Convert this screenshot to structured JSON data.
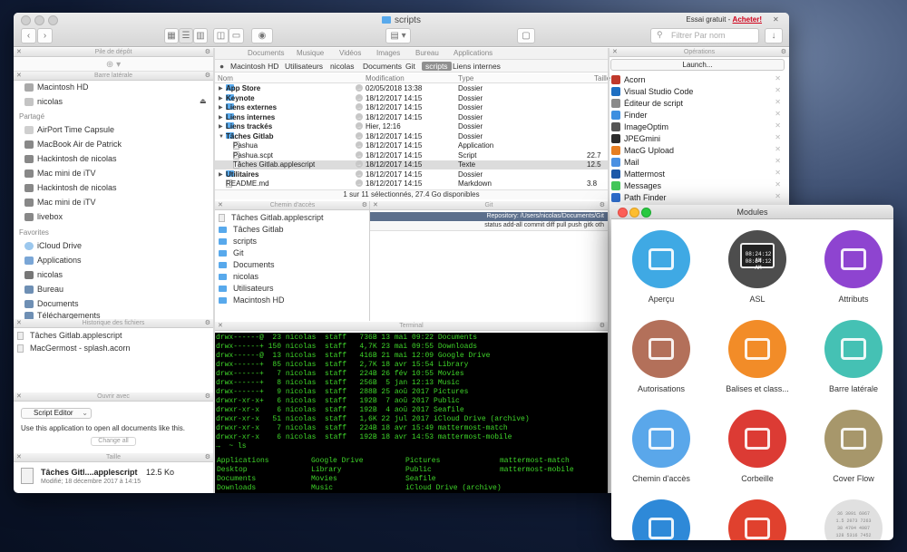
{
  "window": {
    "title": "scripts",
    "trial_label": "Essai gratuit - ",
    "trial_link": "Acheter!",
    "search_placeholder": "Filtrer Par nom"
  },
  "panels": {
    "stack": "Pile de dépôt",
    "sidebar": "Barre latérale",
    "history": "Historique des fichiers",
    "openwith": "Ouvrir avec",
    "size": "Taille",
    "path": "Chemin d'accès",
    "git": "Git",
    "terminal": "Terminal",
    "operations": "Opérations"
  },
  "sidebar": {
    "top": [
      {
        "label": "Macintosh HD"
      },
      {
        "label": "nicolas"
      }
    ],
    "shared_title": "Partagé",
    "shared": [
      {
        "label": "AirPort Time Capsule"
      },
      {
        "label": "MacBook Air de Patrick"
      },
      {
        "label": "Hackintosh de nicolas"
      },
      {
        "label": "Mac mini de iTV"
      },
      {
        "label": "Hackintosh de nicolas"
      },
      {
        "label": "Mac mini de iTV"
      },
      {
        "label": "livebox"
      }
    ],
    "fav_title": "Favorites",
    "favorites": [
      {
        "label": "iCloud Drive"
      },
      {
        "label": "Applications"
      },
      {
        "label": "nicolas"
      },
      {
        "label": "Bureau"
      },
      {
        "label": "Documents"
      },
      {
        "label": "Téléchargements"
      }
    ]
  },
  "history": [
    {
      "label": "Tâches Gitlab.applescript"
    },
    {
      "label": "MacGermost - splash.acorn"
    }
  ],
  "openwith": {
    "app": "Script Editor",
    "desc": "Use this application to open all documents like this.",
    "change": "Change all"
  },
  "sizeinfo": {
    "name": "Tâches Gitl....applescript",
    "size": "12.5 Ko",
    "modified": "Modifié; 18 décembre 2017 à 14:15"
  },
  "menubar": [
    "Documents",
    "Musique",
    "Vidéos",
    "Images",
    "Bureau",
    "Applications"
  ],
  "breadcrumbs": [
    "Macintosh HD",
    "Utilisateurs",
    "nicolas",
    "Documents",
    "Git",
    "scripts",
    "Liens internes"
  ],
  "columns": {
    "name": "Nom",
    "modified": "Modification",
    "type": "Type",
    "size": "Taille"
  },
  "files": [
    {
      "name": "App Store",
      "date": "02/05/2018 13:38",
      "type": "Dossier",
      "size": "",
      "folder": true,
      "bold": true,
      "exp": "▶"
    },
    {
      "name": "Keynote",
      "date": "18/12/2017 14:15",
      "type": "Dossier",
      "size": "",
      "folder": true,
      "bold": true,
      "exp": "▶"
    },
    {
      "name": "Liens externes",
      "date": "18/12/2017 14:15",
      "type": "Dossier",
      "size": "",
      "folder": true,
      "bold": true,
      "exp": "▶"
    },
    {
      "name": "Liens internes",
      "date": "18/12/2017 14:15",
      "type": "Dossier",
      "size": "",
      "folder": true,
      "bold": true,
      "exp": "▶"
    },
    {
      "name": "Liens trackés",
      "date": "Hier, 12:16",
      "type": "Dossier",
      "size": "",
      "folder": true,
      "bold": true,
      "exp": "▶"
    },
    {
      "name": "Tâches Gitlab",
      "date": "18/12/2017 14:15",
      "type": "Dossier",
      "size": "",
      "folder": true,
      "bold": true,
      "exp": "▼"
    },
    {
      "name": "Pashua",
      "date": "18/12/2017 14:15",
      "type": "Application",
      "size": "",
      "folder": false,
      "bold": false,
      "exp": ""
    },
    {
      "name": "Pashua.scpt",
      "date": "18/12/2017 14:15",
      "type": "Script",
      "size": "22.7",
      "folder": false,
      "bold": false,
      "exp": ""
    },
    {
      "name": "Tâches Gitlab.applescript",
      "date": "18/12/2017 14:15",
      "type": "Texte",
      "size": "12.5",
      "folder": false,
      "bold": false,
      "exp": ""
    },
    {
      "name": "Utilitaires",
      "date": "18/12/2017 14:15",
      "type": "Dossier",
      "size": "",
      "folder": true,
      "bold": true,
      "exp": "▶"
    },
    {
      "name": "README.md",
      "date": "18/12/2017 14:15",
      "type": "Markdown",
      "size": "3.8",
      "folder": false,
      "bold": false,
      "exp": ""
    }
  ],
  "status_text": "1 sur 11 sélectionnés, 27.4 Go disponibles",
  "pathlist": [
    "Tâches Gitlab.applescript",
    "Tâches Gitlab",
    "scripts",
    "Git",
    "Documents",
    "nicolas",
    "Utilisateurs",
    "Macintosh HD"
  ],
  "git": {
    "repo": "Repository: /Users/nicolas/Documents/Git",
    "buttons": "status  add-all  commit  diff  pull  push  gitk  oth"
  },
  "terminal": {
    "lines": [
      "drwx------@  23 nicolas  staff   736B 13 mai 09:22 Documents",
      "drwx------+ 150 nicolas  staff   4,7K 23 mai 09:55 Downloads",
      "drwx------@  13 nicolas  staff   416B 21 mai 12:09 Google Drive",
      "drwx------+  85 nicolas  staff   2,7K 18 avr 15:54 Library",
      "drwx------+   7 nicolas  staff   224B 26 fév 10:55 Movies",
      "drwx------+   8 nicolas  staff   256B  5 jan 12:13 Music",
      "drwx------+   9 nicolas  staff   288B 25 aoû 2017 Pictures",
      "drwxr-xr-x+   6 nicolas  staff   192B  7 aoû 2017 Public",
      "drwxr-xr-x    6 nicolas  staff   192B  4 aoû 2017 Seafile",
      "drwxr-xr-x   51 nicolas  staff   1,6K 22 jul 2017 iCloud Drive (archive)",
      "drwxr-xr-x    7 nicolas  staff   224B 18 avr 15:49 mattermost-match",
      "drwxr-xr-x    6 nicolas  staff   192B 18 avr 14:53 mattermost-mobile",
      "→  ~ ls"
    ],
    "cols": [
      [
        "Applications",
        "Desktop",
        "Documents",
        "Downloads"
      ],
      [
        "Google Drive",
        "Library",
        "Movies",
        "Music"
      ],
      [
        "Pictures",
        "Public",
        "Seafile",
        "iCloud Drive (archive)"
      ],
      [
        "mattermost-match",
        "mattermost-mobile",
        "",
        ""
      ]
    ],
    "prompt": "→  ~ "
  },
  "operations": {
    "launch": "Launch...",
    "items": [
      {
        "label": "Acorn",
        "color": "#c0392b"
      },
      {
        "label": "Visual Studio Code",
        "color": "#1e6fc2"
      },
      {
        "label": "Éditeur de script",
        "color": "#8a8a8a"
      },
      {
        "label": "Finder",
        "color": "#3d8fe0"
      },
      {
        "label": "ImageOptim",
        "color": "#555555"
      },
      {
        "label": "JPEGmini",
        "color": "#2b2b2b"
      },
      {
        "label": "MacG Upload",
        "color": "#e67e22"
      },
      {
        "label": "Mail",
        "color": "#4a90e2"
      },
      {
        "label": "Mattermost",
        "color": "#1c58a8"
      },
      {
        "label": "Messages",
        "color": "#43c75a"
      },
      {
        "label": "Path Finder",
        "color": "#2f6fcf"
      }
    ]
  },
  "modules": {
    "title": "Modules",
    "items": [
      {
        "label": "Aperçu",
        "color": "#3fa9e4"
      },
      {
        "label": "ASL",
        "color": "#4d4d4d"
      },
      {
        "label": "Attributs",
        "color": "#8e44d0"
      },
      {
        "label": "Autorisations",
        "color": "#b3705a"
      },
      {
        "label": "Balises et class...",
        "color": "#f28c28"
      },
      {
        "label": "Barre latérale",
        "color": "#45c1b4"
      },
      {
        "label": "Chemin d'accès",
        "color": "#5aa7ea"
      },
      {
        "label": "Corbeille",
        "color": "#dc3b34"
      },
      {
        "label": "Cover Flow",
        "color": "#a7976b"
      },
      {
        "label": "",
        "color": "#2e89d8"
      },
      {
        "label": "",
        "color": "#e0412e"
      },
      {
        "label": "",
        "color": "#e0e0e0"
      }
    ]
  },
  "asl_times": [
    "08:24:12 AM",
    "08:24:12 AM"
  ],
  "grid_numbers": [
    "36",
    "1.5",
    "38",
    "128",
    "3091 6067",
    "2073 7263",
    "4704 4987",
    "5316 7452"
  ]
}
